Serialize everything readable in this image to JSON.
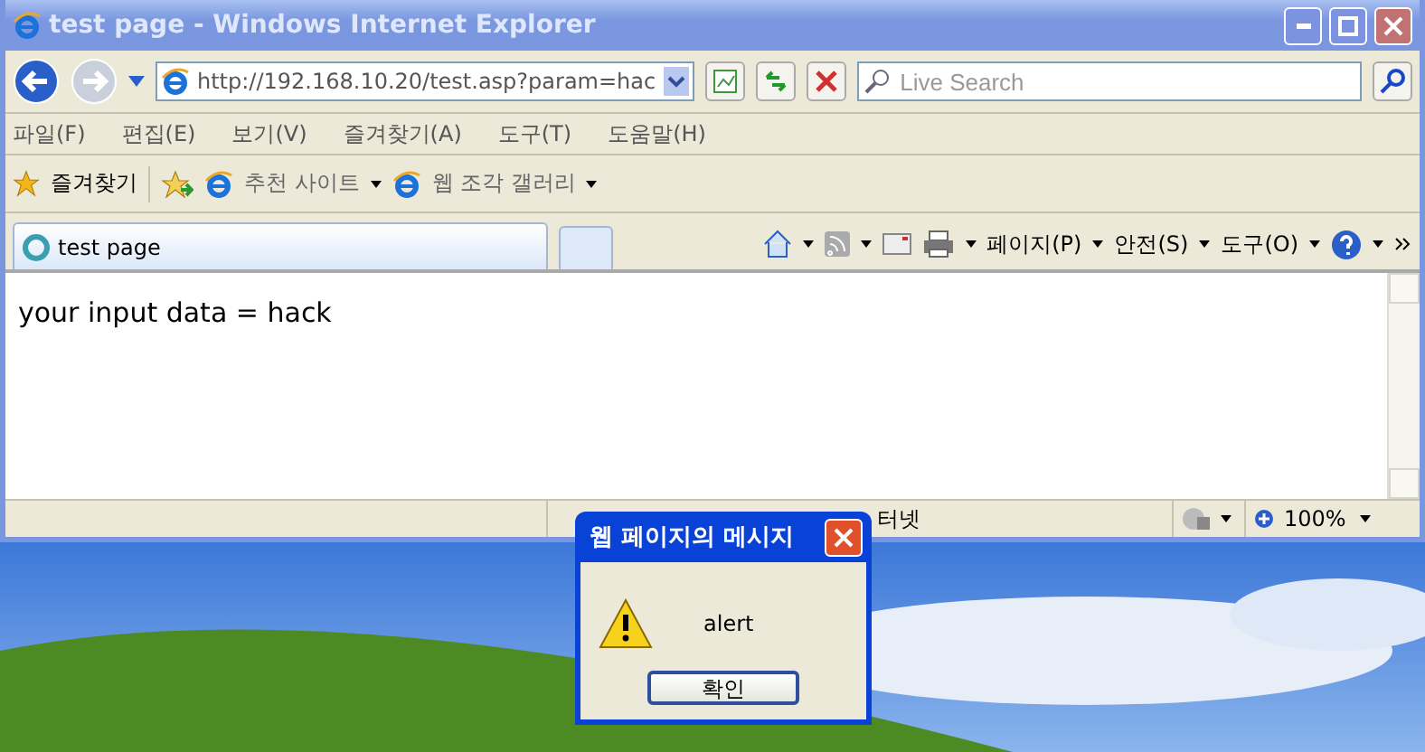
{
  "window": {
    "title": "test page - Windows Internet Explorer"
  },
  "address": {
    "url": "http://192.168.10.20/test.asp?param=hac"
  },
  "search": {
    "placeholder": "Live Search"
  },
  "menu": [
    "파일(F)",
    "편집(E)",
    "보기(V)",
    "즐겨찾기(A)",
    "도구(T)",
    "도움말(H)"
  ],
  "favorites": {
    "label": "즐겨찾기",
    "links": [
      "추천 사이트",
      "웹 조각 갤러리"
    ]
  },
  "tabs": [
    {
      "label": "test page",
      "selected": true
    }
  ],
  "commands": [
    "페이지(P)",
    "안전(S)",
    "도구(O)"
  ],
  "content": {
    "text": "your input data = hack"
  },
  "status_bar": {
    "zone": "터넷",
    "zoom": "100%"
  },
  "dialog": {
    "title": "웹 페이지의 메시지",
    "message": "alert",
    "button": "확인"
  }
}
